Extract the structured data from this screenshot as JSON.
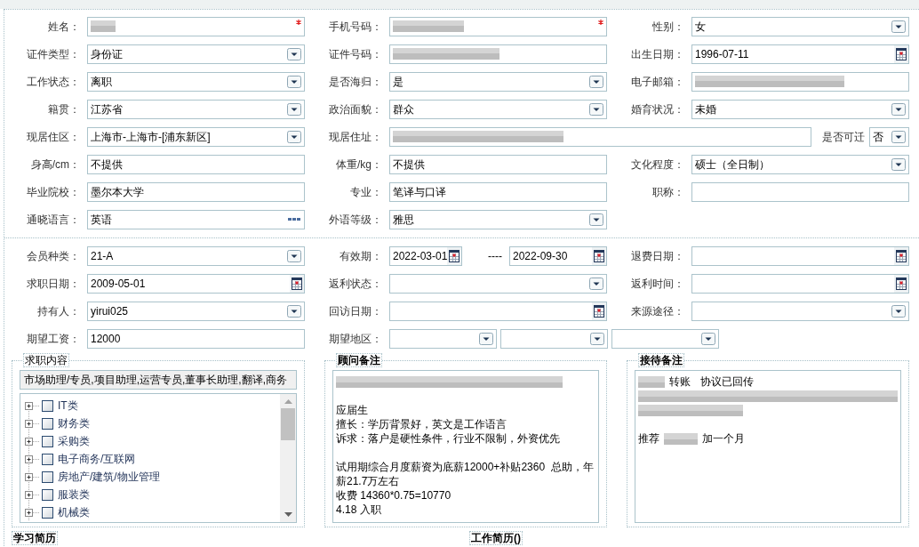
{
  "personal_info": {
    "rows": [
      [
        {
          "label": "姓名：",
          "kind": "text",
          "redacted": true,
          "required": true
        },
        {
          "label": "手机号码：",
          "kind": "text",
          "redacted": true,
          "required": true
        },
        {
          "label": "性别：",
          "kind": "select",
          "value": "女"
        }
      ],
      [
        {
          "label": "证件类型：",
          "kind": "select",
          "value": "身份证"
        },
        {
          "label": "证件号码：",
          "kind": "text",
          "redacted": true
        },
        {
          "label": "出生日期：",
          "kind": "date",
          "value": "1996-07-11"
        }
      ],
      [
        {
          "label": "工作状态：",
          "kind": "select",
          "value": "离职"
        },
        {
          "label": "是否海归：",
          "kind": "select",
          "value": "是"
        },
        {
          "label": "电子邮箱：",
          "kind": "text",
          "redacted": true
        }
      ],
      [
        {
          "label": "籍贯：",
          "kind": "select",
          "value": "江苏省"
        },
        {
          "label": "政治面貌：",
          "kind": "select",
          "value": "群众"
        },
        {
          "label": "婚育状况：",
          "kind": "select",
          "value": "未婚"
        }
      ],
      [
        {
          "label": "现居住区：",
          "kind": "select",
          "value": "上海市-上海市-[浦东新区]"
        },
        {
          "label": "现居住址：",
          "kind": "text",
          "redacted": true
        },
        {
          "label": "是否可迁",
          "kind": "compact_select",
          "value": "否"
        }
      ],
      [
        {
          "label": "身高/cm：",
          "kind": "text",
          "value": "不提供"
        },
        {
          "label": "体重/kg：",
          "kind": "text",
          "value": "不提供"
        },
        {
          "label": "文化程度：",
          "kind": "select",
          "value": "硕士（全日制）"
        }
      ],
      [
        {
          "label": "毕业院校：",
          "kind": "text",
          "value": "墨尔本大学"
        },
        {
          "label": "专业：",
          "kind": "text",
          "value": "笔译与口译"
        },
        {
          "label": "职称：",
          "kind": "text"
        }
      ],
      [
        {
          "label": "通晓语言：",
          "kind": "picker",
          "value": "英语"
        },
        {
          "label": "外语等级：",
          "kind": "select",
          "value": "雅思"
        }
      ]
    ]
  },
  "membership": {
    "rows": [
      [
        {
          "label": "会员种类：",
          "kind": "select",
          "value": "21-A"
        },
        {
          "label": "有效期：",
          "kind": "date_range",
          "from": "2022-03-01",
          "separator": "----",
          "to": "2022-09-30"
        },
        {
          "label": "退费日期：",
          "kind": "date"
        }
      ],
      [
        {
          "label": "求职日期：",
          "kind": "date",
          "value": "2009-05-01"
        },
        {
          "label": "返利状态：",
          "kind": "select"
        },
        {
          "label": "返利时间：",
          "kind": "date"
        }
      ],
      [
        {
          "label": "持有人：",
          "kind": "select",
          "value": "yirui025"
        },
        {
          "label": "回访日期：",
          "kind": "date"
        },
        {
          "label": "来源途径：",
          "kind": "select"
        }
      ],
      [
        {
          "label": "期望工资：",
          "kind": "text",
          "value": "12000"
        },
        {
          "label": "期望地区：",
          "kind": "select_group",
          "parts": [
            {
              "kind": "select"
            },
            {
              "kind": "select"
            },
            {
              "kind": "select"
            }
          ]
        }
      ]
    ]
  },
  "job_intent": {
    "legend": "求职内容",
    "summary": "市场助理/专员,项目助理,运营专员,董事长助理,翻译,商务",
    "categories": [
      {
        "label": "IT类",
        "expanded": false,
        "checked": false
      },
      {
        "label": "财务类",
        "expanded": false,
        "checked": false
      },
      {
        "label": "采购类",
        "expanded": false,
        "checked": false
      },
      {
        "label": "电子商务/互联网",
        "expanded": false,
        "checked": false
      },
      {
        "label": "房地产/建筑/物业管理",
        "expanded": false,
        "checked": false
      },
      {
        "label": "服装类",
        "expanded": false,
        "checked": false
      },
      {
        "label": "机械类",
        "expanded": false,
        "checked": false
      }
    ]
  },
  "consultant_notes": {
    "legend": "顾问备注",
    "lines": [
      {
        "kind": "redacted"
      },
      {
        "kind": "blank"
      },
      {
        "kind": "text",
        "text": "应届生"
      },
      {
        "kind": "text",
        "text": "擅长：学历背景好，英文是工作语言"
      },
      {
        "kind": "text",
        "text": "诉求：落户是硬性条件，行业不限制，外资优先"
      },
      {
        "kind": "blank"
      },
      {
        "kind": "text",
        "text": "试用期综合月度薪资为底薪12000+补贴2360  总助，年薪21.7万左右"
      },
      {
        "kind": "text",
        "text": "收费 14360*0.75=10770"
      },
      {
        "kind": "text",
        "text": "4.18 入职"
      }
    ]
  },
  "reception_notes": {
    "legend": "接待备注",
    "lines": [
      {
        "kind": "mixed",
        "segments": [
          {
            "kind": "redacted"
          },
          {
            "kind": "text",
            "text": "转账"
          },
          {
            "kind": "text",
            "text": "协议已回传"
          }
        ]
      },
      {
        "kind": "redacted"
      },
      {
        "kind": "redacted"
      },
      {
        "kind": "blank"
      },
      {
        "kind": "mixed",
        "segments": [
          {
            "kind": "text",
            "text": "推荐"
          },
          {
            "kind": "redacted"
          },
          {
            "kind": "text",
            "text": "加一个月"
          }
        ]
      }
    ]
  },
  "next_sections": [
    {
      "legend": "学习简历"
    },
    {
      "legend": "工作简历()"
    }
  ]
}
